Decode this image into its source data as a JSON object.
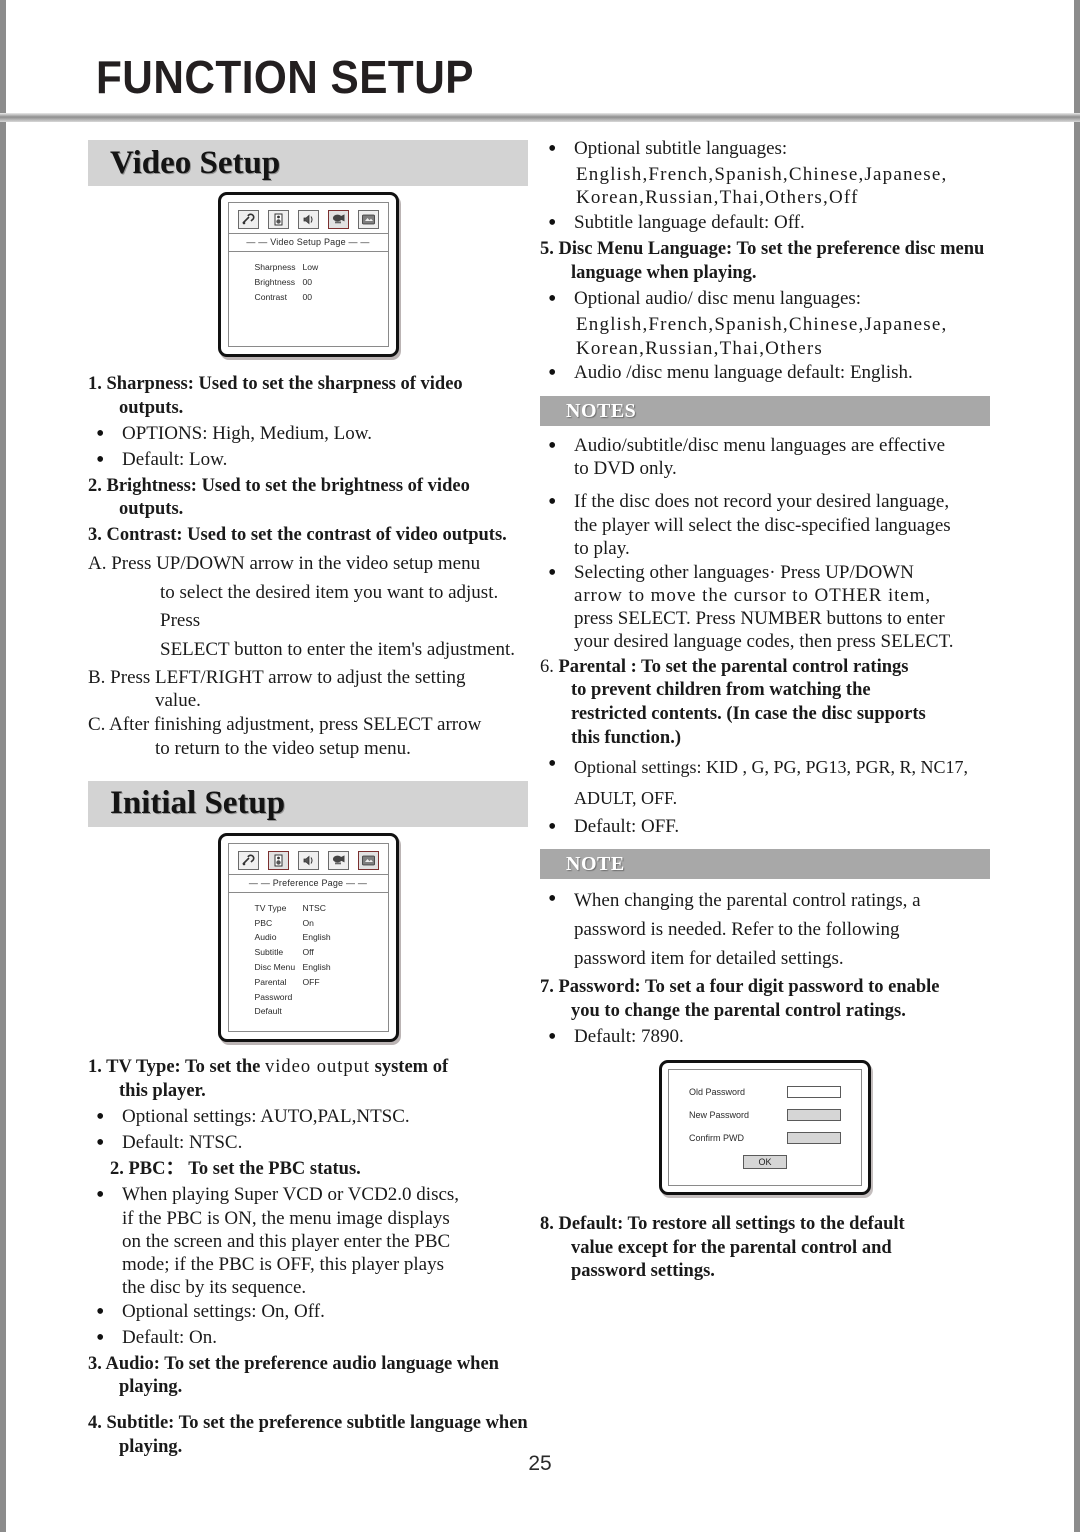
{
  "header": {
    "title": "FUNCTION SETUP"
  },
  "page_number": "25",
  "left": {
    "video_setup": {
      "bar_label": "Video Setup",
      "osd": {
        "page_title": "— — Video Setup Page — —",
        "icons": [
          "tool-icon",
          "speaker-icon",
          "audio-icon",
          "video-camera-icon",
          "display-icon"
        ],
        "selected_icon_index": 3,
        "rows": [
          {
            "key": "Sharpness",
            "value": "Low"
          },
          {
            "key": "Brightness",
            "value": "00"
          },
          {
            "key": "Contrast",
            "value": "00"
          }
        ]
      },
      "item1": "1. Sharpness: Used to set the sharpness of video outputs.",
      "item1_b1": "OPTIONS: High, Medium, Low.",
      "item1_b2": "Default: Low.",
      "item2": "2. Brightness: Used to set the brightness of video outputs.",
      "item3": "3. Contrast: Used to set the contrast of video outputs.",
      "itemA_l1": "A. Press UP/DOWN arrow in the video setup menu",
      "itemA_l2": "to select the desired item you want to adjust. Press",
      "itemA_l3": "SELECT button to enter the item's adjustment.",
      "itemB_l1": "B. Press LEFT/RIGHT arrow to adjust the setting",
      "itemB_l2": "value.",
      "itemC_l1": "C. After finishing adjustment, press SELECT arrow",
      "itemC_l2": "to return to the video setup menu."
    },
    "initial_setup": {
      "bar_label": "Initial Setup",
      "osd": {
        "page_title": "— — Preference Page — —",
        "icons": [
          "tool-icon",
          "speaker-icon",
          "audio-icon",
          "video-camera-icon",
          "display-icon"
        ],
        "selected_icon_index": 4,
        "rows": [
          {
            "key": "TV Type",
            "value": "NTSC"
          },
          {
            "key": "PBC",
            "value": "On"
          },
          {
            "key": "Audio",
            "value": "English"
          },
          {
            "key": "Subtitle",
            "value": "Off"
          },
          {
            "key": "Disc Menu",
            "value": "English"
          },
          {
            "key": "Parental",
            "value": "OFF"
          },
          {
            "key": "Password",
            "value": ""
          },
          {
            "key": "Default",
            "value": ""
          }
        ]
      },
      "item1_a": "1. TV Type: To set the",
      "item1_mid": "video output",
      "item1_b": "system of",
      "item1_l2": "this player.",
      "item1_b1": "Optional settings: AUTO,PAL,NTSC.",
      "item1_b2": "Default: NTSC.",
      "item2": "2. PBC：  To set the PBC status.",
      "item2_b1_l1": "When playing Super VCD or VCD2.0 discs,",
      "item2_b1_l2": "if the PBC is ON, the menu image displays",
      "item2_b1_l3": "on the screen and this player enter the PBC",
      "item2_b1_l4": "mode; if the PBC is OFF, this player plays",
      "item2_b1_l5": "the disc by its sequence.",
      "item2_b2": "Optional settings: On, Off.",
      "item2_b3": "Default: On.",
      "item3": "3. Audio: To set the preference audio language when playing.",
      "item4": "4. Subtitle: To set the preference subtitle language when playing."
    }
  },
  "right": {
    "subtitle_b1": "Optional subtitle  languages:",
    "subtitle_langs_l1": "English,French,Spanish,Chinese,Japanese,",
    "subtitle_langs_l2": "Korean,Russian,Thai,Others,Off",
    "subtitle_b2": "Subtitle  language default: Off.",
    "item5": "5. Disc Menu Language: To set the preference disc menu language when playing.",
    "item5_b1": "Optional audio/ disc menu languages:",
    "item5_langs_l1": "English,French,Spanish,Chinese,Japanese,",
    "item5_langs_l2": "Korean,Russian,Thai,Others",
    "item5_b2": "Audio /disc menu language default: English.",
    "notes_bar": "NOTES",
    "note1_l1": "Audio/subtitle/disc menu languages are effective",
    "note1_l2": "to DVD only.",
    "note2_l1": "If the disc does not record your desired language,",
    "note2_l2": "the player will select the disc-specified languages",
    "note2_l3": "to play.",
    "note3_l1": "Selecting other languages· Press UP/DOWN",
    "note3_l2": "arrow to move the cursor to OTHER item,",
    "note3_l3": "press SELECT. Press NUMBER buttons to enter",
    "note3_l4": "your desired language codes, then press SELECT.",
    "item6_num": "6.",
    "item6_l1": "Parental : To set the parental control ratings",
    "item6_l2": "to prevent children from watching the",
    "item6_l3": "restricted contents. (In case the disc supports",
    "item6_l4": "this function.)",
    "item6_b1_l1": "Optional settings: KID , G, PG, PG13, PGR, R, NC17,",
    "item6_b1_l2": "ADULT, OFF.",
    "item6_b2": "Default: OFF.",
    "note_bar": "NOTE",
    "note4_l1": "When changing the parental control ratings, a",
    "note4_l2": "password is needed. Refer to the following",
    "note4_l3": "password item for detailed settings.",
    "item7_l1": "7. Password: To set a four digit password to enable",
    "item7_l2": "you to change the parental control ratings.",
    "item7_b1": "Default: 7890.",
    "pwd_dialog": {
      "row1_label": "Old Password",
      "row2_label": "New Password",
      "row3_label": "Confirm PWD",
      "ok_label": "OK"
    },
    "item8_l1": "8. Default: To restore all settings to the default",
    "item8_l2": "value except for the parental control and",
    "item8_l3": "password settings."
  }
}
